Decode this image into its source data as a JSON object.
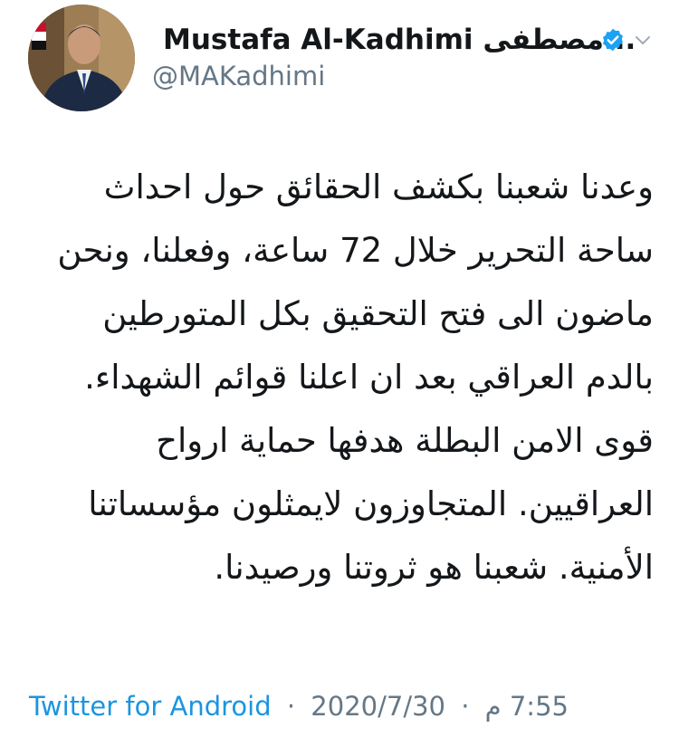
{
  "author": {
    "display_name": "Mustafa Al-Kadhimi مصطفى...",
    "handle": "@MAKadhimi",
    "verified": true
  },
  "tweet": {
    "paragraphs": [
      "وعدنا شعبنا بكشف الحقائق حول احداث ساحة التحرير خلال 72 ساعة، وفعلنا، ونحن ماضون الى فتح التحقيق بكل المتورطين بالدم العراقي بعد ان اعلنا قوائم الشهداء.",
      "قوى الامن البطلة هدفها حماية ارواح العراقيين. المتجاوزون لايمثلون مؤسساتنا الأمنية. شعبنا هو ثروتنا ورصيدنا."
    ]
  },
  "meta": {
    "source": "Twitter for Android",
    "date": "2020/7/30",
    "time": "7:55 م",
    "separator": "·"
  },
  "colors": {
    "accent": "#1b95e0",
    "muted": "#657786",
    "text": "#14171a"
  },
  "icons": {
    "verified": "verified-badge-icon",
    "menu": "chevron-down-icon"
  }
}
